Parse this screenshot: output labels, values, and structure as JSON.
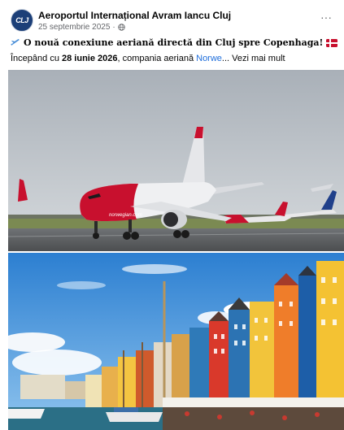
{
  "post": {
    "page_name": "Aeroportul Internațional Avram Iancu Cluj",
    "date": "25 septembrie 2025",
    "separator": "·",
    "more_label": "···",
    "avatar_label": "CLJ",
    "headline": "O nouă conexiune aeriană directă din Cluj spre Copenhaga!",
    "body": {
      "prefix": "Începând cu ",
      "date": "28 iunie 2026",
      "middle": ", compania aeriană ",
      "airline": "Norwe",
      "ellipsis": "... ",
      "see_more": "Vezi mai mult"
    }
  },
  "photos": [
    {
      "subject": "plane",
      "tail_text": "norwegian.com"
    },
    {
      "subject": "city"
    }
  ],
  "colors": {
    "link": "#216fdb",
    "secondary_text": "#65676b",
    "plane_body": "#c8102e"
  },
  "icons": [
    "globe-icon",
    "airplane-icon",
    "danish-flag-icon",
    "more-options-icon"
  ]
}
